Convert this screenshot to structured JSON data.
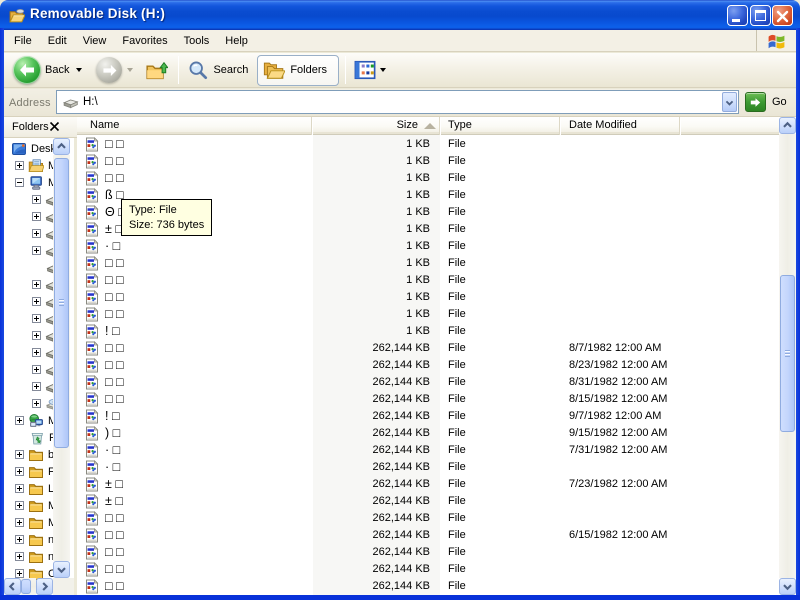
{
  "window": {
    "title": "Removable Disk (H:)"
  },
  "colors": {
    "titlebar_blue": "#0A4CD0",
    "window_border": "#0831D9",
    "face": "#ECE9D8",
    "tooltip_bg": "#FFFFE1",
    "sorted_column_bg": "#F7F7F5",
    "close_button_red": "#CC4520",
    "go_button_green": "#3D9A32"
  },
  "menu": {
    "items": [
      {
        "label": "File"
      },
      {
        "label": "Edit"
      },
      {
        "label": "View"
      },
      {
        "label": "Favorites"
      },
      {
        "label": "Tools"
      },
      {
        "label": "Help"
      }
    ]
  },
  "toolbar": {
    "back_label": "Back",
    "search_label": "Search",
    "folders_label": "Folders"
  },
  "addressbar": {
    "label": "Address",
    "value": "H:\\",
    "go_label": "Go"
  },
  "explorer_bar": {
    "title": "Folders"
  },
  "columns": {
    "name": "Name",
    "size": "Size",
    "type": "Type",
    "date": "Date Modified"
  },
  "tree": {
    "items": [
      {
        "label": "Desk",
        "icon": "desktop",
        "expander": "none",
        "pad": 7
      },
      {
        "label": "M",
        "icon": "mydocs",
        "expander": "plus",
        "pad": 11
      },
      {
        "label": "M",
        "icon": "mycomputer",
        "expander": "minus",
        "pad": 11
      },
      {
        "label": "",
        "icon": "drive",
        "expander": "plus",
        "pad": 28
      },
      {
        "label": "",
        "icon": "drive",
        "expander": "plus",
        "pad": 28
      },
      {
        "label": "",
        "icon": "drive",
        "expander": "plus",
        "pad": 28
      },
      {
        "label": "",
        "icon": "drive",
        "expander": "plus",
        "pad": 28
      },
      {
        "label": "",
        "icon": "drive",
        "expander": "none",
        "pad": 42
      },
      {
        "label": "",
        "icon": "drive",
        "expander": "plus",
        "pad": 28
      },
      {
        "label": "",
        "icon": "drive",
        "expander": "plus",
        "pad": 28
      },
      {
        "label": "",
        "icon": "drive",
        "expander": "plus",
        "pad": 28
      },
      {
        "label": "",
        "icon": "drive",
        "expander": "plus",
        "pad": 28
      },
      {
        "label": "",
        "icon": "drive",
        "expander": "plus",
        "pad": 28
      },
      {
        "label": "",
        "icon": "drive",
        "expander": "plus",
        "pad": 28
      },
      {
        "label": "",
        "icon": "drive",
        "expander": "plus",
        "pad": 28
      },
      {
        "label": "",
        "icon": "cdrive",
        "expander": "plus",
        "pad": 28
      },
      {
        "label": "M",
        "icon": "network",
        "expander": "plus",
        "pad": 11
      },
      {
        "label": "R",
        "icon": "recycle",
        "expander": "none",
        "pad": 25
      },
      {
        "label": "b",
        "icon": "folder",
        "expander": "plus",
        "pad": 11
      },
      {
        "label": "F",
        "icon": "folder",
        "expander": "plus",
        "pad": 11
      },
      {
        "label": "L",
        "icon": "folder",
        "expander": "plus",
        "pad": 11
      },
      {
        "label": "M",
        "icon": "folder",
        "expander": "plus",
        "pad": 11
      },
      {
        "label": "M",
        "icon": "folder",
        "expander": "plus",
        "pad": 11
      },
      {
        "label": "n",
        "icon": "folder",
        "expander": "plus",
        "pad": 11
      },
      {
        "label": "n",
        "icon": "folder",
        "expander": "plus",
        "pad": 11
      },
      {
        "label": "C",
        "icon": "folder",
        "expander": "plus",
        "pad": 11
      }
    ]
  },
  "files": [
    {
      "name": "□□",
      "size": "1 KB",
      "type": "File",
      "date": ""
    },
    {
      "name": "□□",
      "size": "1 KB",
      "type": "File",
      "date": ""
    },
    {
      "name": "□□",
      "size": "1 KB",
      "type": "File",
      "date": ""
    },
    {
      "name": "ß□",
      "size": "1 KB",
      "type": "File",
      "date": ""
    },
    {
      "name": "Θ□",
      "size": "1 KB",
      "type": "File",
      "date": ""
    },
    {
      "name": "±□",
      "size": "1 KB",
      "type": "File",
      "date": ""
    },
    {
      "name": "·□",
      "size": "1 KB",
      "type": "File",
      "date": ""
    },
    {
      "name": "□□",
      "size": "1 KB",
      "type": "File",
      "date": ""
    },
    {
      "name": "□□",
      "size": "1 KB",
      "type": "File",
      "date": ""
    },
    {
      "name": "□□",
      "size": "1 KB",
      "type": "File",
      "date": ""
    },
    {
      "name": "□□",
      "size": "1 KB",
      "type": "File",
      "date": ""
    },
    {
      "name": "!□",
      "size": "1 KB",
      "type": "File",
      "date": ""
    },
    {
      "name": "□□",
      "size": "262,144 KB",
      "type": "File",
      "date": "8/7/1982 12:00 AM"
    },
    {
      "name": "□□",
      "size": "262,144 KB",
      "type": "File",
      "date": "8/23/1982 12:00 AM"
    },
    {
      "name": "□□",
      "size": "262,144 KB",
      "type": "File",
      "date": "8/31/1982 12:00 AM"
    },
    {
      "name": "□□",
      "size": "262,144 KB",
      "type": "File",
      "date": "8/15/1982 12:00 AM"
    },
    {
      "name": "!□",
      "size": "262,144 KB",
      "type": "File",
      "date": "9/7/1982 12:00 AM"
    },
    {
      "name": ")□",
      "size": "262,144 KB",
      "type": "File",
      "date": "9/15/1982 12:00 AM"
    },
    {
      "name": "·□",
      "size": "262,144 KB",
      "type": "File",
      "date": "7/31/1982 12:00 AM"
    },
    {
      "name": "·□",
      "size": "262,144 KB",
      "type": "File",
      "date": ""
    },
    {
      "name": "±□",
      "size": "262,144 KB",
      "type": "File",
      "date": "7/23/1982 12:00 AM"
    },
    {
      "name": "±□",
      "size": "262,144 KB",
      "type": "File",
      "date": ""
    },
    {
      "name": "□□",
      "size": "262,144 KB",
      "type": "File",
      "date": ""
    },
    {
      "name": "□□",
      "size": "262,144 KB",
      "type": "File",
      "date": "6/15/1982 12:00 AM"
    },
    {
      "name": "□□",
      "size": "262,144 KB",
      "type": "File",
      "date": ""
    },
    {
      "name": "□□",
      "size": "262,144 KB",
      "type": "File",
      "date": ""
    },
    {
      "name": "□□",
      "size": "262,144 KB",
      "type": "File",
      "date": ""
    }
  ],
  "tooltip": {
    "line1": "Type: File",
    "line2": "Size: 736 bytes"
  }
}
